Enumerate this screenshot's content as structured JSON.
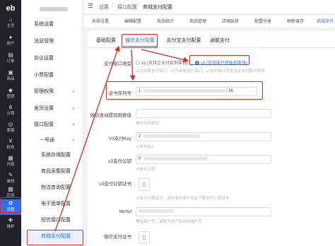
{
  "rail": {
    "logo": "eb",
    "items": [
      {
        "label": "主页",
        "icon": "home-icon"
      },
      {
        "label": "用户",
        "icon": "user-icon"
      },
      {
        "label": "订单",
        "icon": "order-icon"
      },
      {
        "label": "商品",
        "icon": "product-icon"
      },
      {
        "label": "营销",
        "icon": "marketing-icon"
      },
      {
        "label": "分销",
        "icon": "distribution-icon"
      },
      {
        "label": "客服",
        "icon": "service-icon"
      },
      {
        "label": "财务",
        "icon": "finance-icon"
      },
      {
        "label": "内容",
        "icon": "content-icon"
      },
      {
        "label": "装修",
        "icon": "decorate-icon"
      },
      {
        "label": "应用",
        "icon": "app-icon"
      },
      {
        "label": "设置",
        "icon": "settings-icon"
      },
      {
        "label": "维护",
        "icon": "maintenance-icon"
      }
    ]
  },
  "menu": {
    "items": [
      {
        "label": "系统设置",
        "chev": ""
      },
      {
        "label": "消息管理",
        "chev": ""
      },
      {
        "label": "协议设置",
        "chev": ""
      },
      {
        "label": "小票配置",
        "chev": ""
      },
      {
        "label": "管理权限",
        "chev": "∨"
      },
      {
        "label": "发货设置",
        "chev": "∨"
      },
      {
        "label": "接口配置",
        "chev": "∧"
      },
      {
        "label": "一号通",
        "chev": "∨"
      },
      {
        "label": "系统存储配置",
        "chev": ""
      },
      {
        "label": "商品采集配置",
        "chev": ""
      },
      {
        "label": "物流查询配置",
        "chev": ""
      },
      {
        "label": "电子面单配置",
        "chev": ""
      },
      {
        "label": "短信接口配置",
        "chev": ""
      },
      {
        "label": "商城支付配置",
        "chev": ""
      }
    ]
  },
  "breadcrumb": [
    "设置",
    "接口配置",
    "商城支付配置"
  ],
  "page_tabs": [
    "系统设置",
    "编辑配置",
    "商品统计",
    "商品管理",
    "店铺装修",
    "配置分类",
    "刷新缓存",
    "商城支付"
  ],
  "sub_tabs": [
    "基础配置",
    "微信支付配置",
    "支付宝支付配置",
    "通联支付"
  ],
  "form": {
    "pay_type_label": "支付接口类型",
    "radio_v2": "v2 (支持企业付款到零钱)",
    "radio_v3": "v3 (支持商户转账到零钱)",
    "pay_type_hint": "v2为旧版支付接口，v3为新版支付接口，v3支付接口不支持企业付款到零钱",
    "cert_serial_label": "证书序列号",
    "cert_serial_prefix": "1",
    "cert_serial_suffix": "56",
    "cert_serial_hint": "",
    "withdraw_label": "微信自动提现限额值",
    "withdraw_hint": "微信自动提现",
    "v3key_label": "V3支付Key",
    "v3key_prefix": "2",
    "v3key_hint": "v3支付key",
    "pubkey_label": "v3支付公钥",
    "pubkey_prefix": "P",
    "pubkey_hint": "v3支付公钥",
    "pubcert_label": "v3支付公钥证书",
    "pubcert_hint": "v3支付公钥证书，请从微信商户后台下载支付公钥证书",
    "mchid_label": "Mchid",
    "mchid_hint": "微信商户号，请填写商户后台的商户号",
    "cert_label": "微信支付证书"
  }
}
